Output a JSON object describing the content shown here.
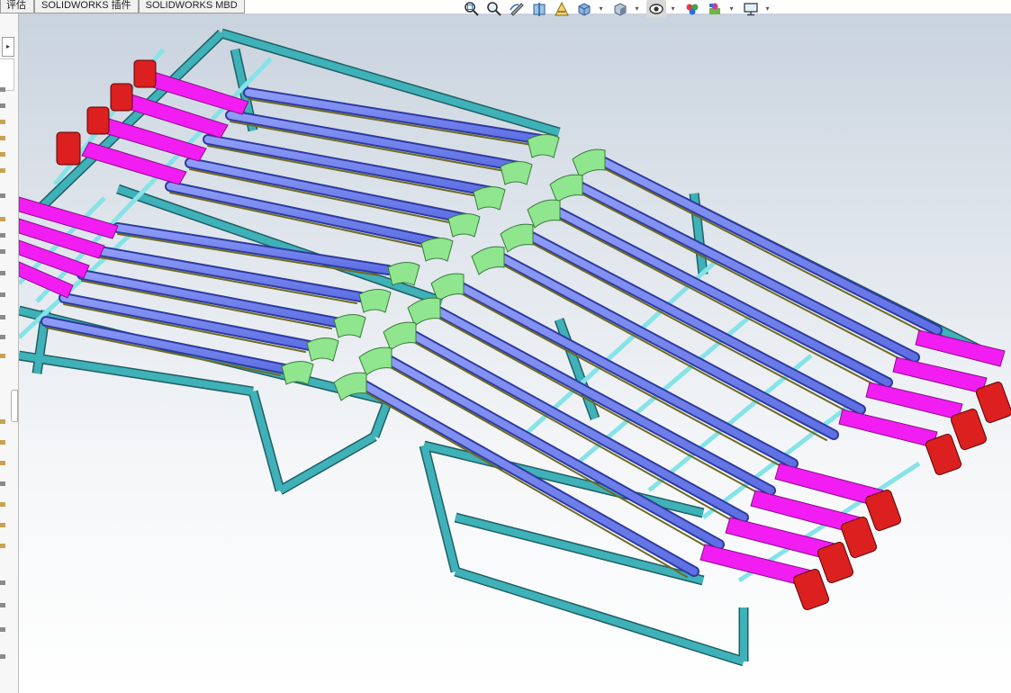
{
  "command_tabs": [
    {
      "label": "评估"
    },
    {
      "label": "SOLIDWORKS 插件"
    },
    {
      "label": "SOLIDWORKS MBD"
    }
  ],
  "heads_up_toolbar": [
    {
      "icon": "zoom-to-fit-icon"
    },
    {
      "icon": "zoom-to-area-icon"
    },
    {
      "icon": "previous-view-icon"
    },
    {
      "icon": "section-view-icon"
    },
    {
      "icon": "dynamic-annotation-icon"
    },
    {
      "icon": "view-orientation-icon"
    },
    {
      "icon": "display-style-icon"
    },
    {
      "icon": "hide-show-items-icon"
    },
    {
      "icon": "edit-appearance-icon"
    },
    {
      "icon": "apply-scene-icon"
    },
    {
      "icon": "view-settings-icon"
    }
  ],
  "colors": {
    "frame": "#3e9ea5",
    "frame_light": "#7fe0e6",
    "belt": "#6d7ff0",
    "belt_dark": "#3b48b8",
    "rail": "#7b7a2e",
    "tray": "#f21df2",
    "motor": "#dc1f1f",
    "transfer": "#8fe68f"
  }
}
